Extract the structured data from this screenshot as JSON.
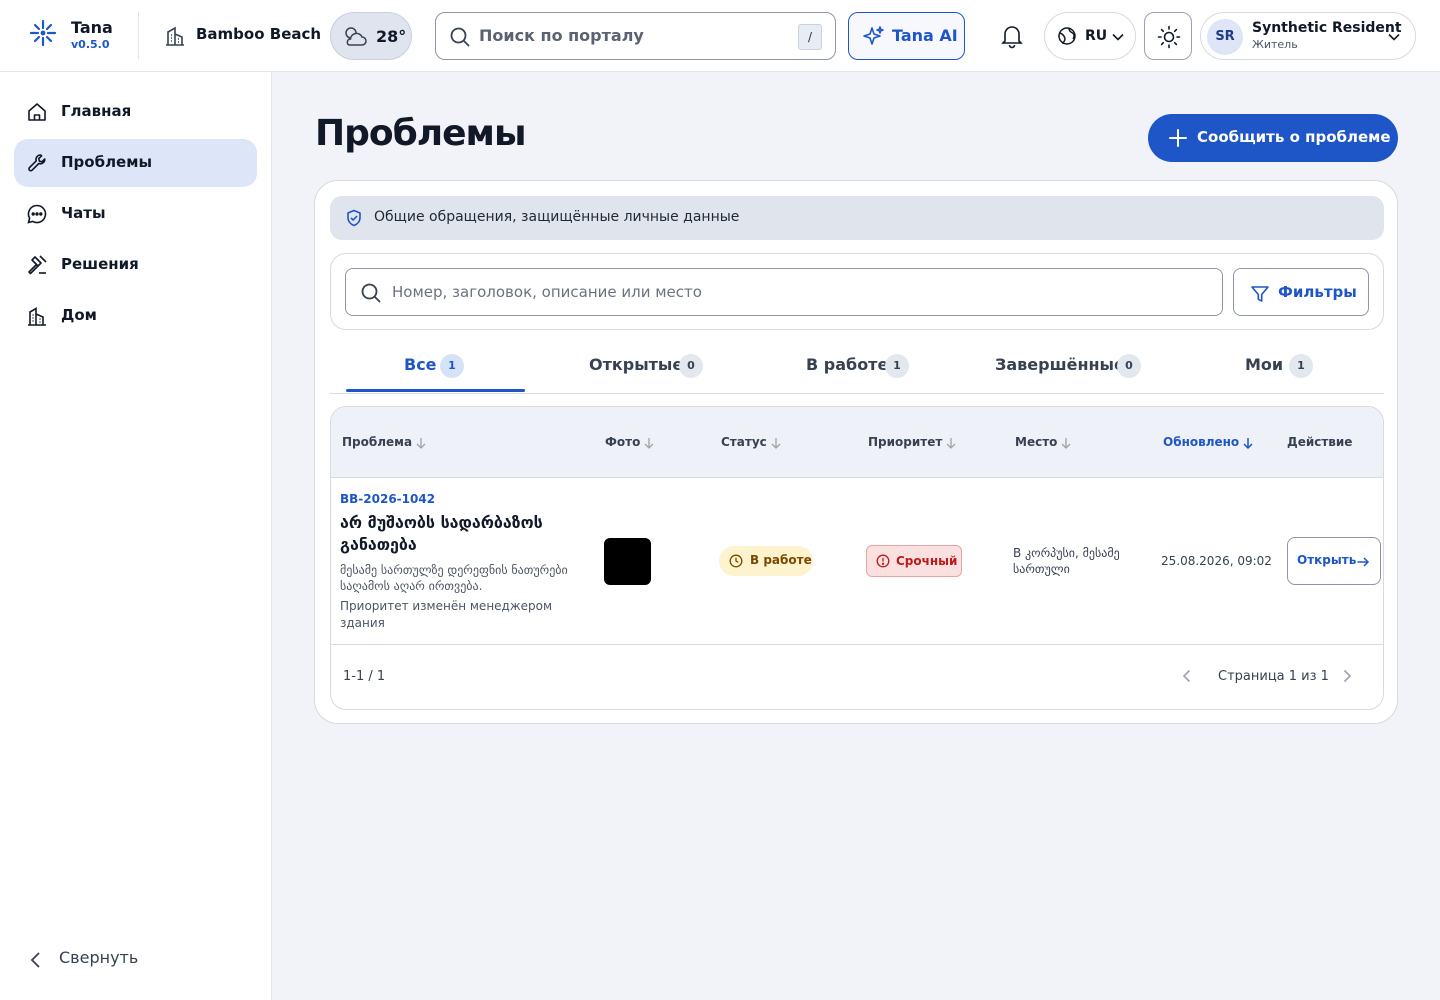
{
  "header": {
    "brand_name": "Tana",
    "brand_version": "v0.5.0",
    "building_name": "Bamboo Beach",
    "weather_temp": "28°",
    "search_placeholder": "Поиск по порталу",
    "search_shortcut": "/",
    "ai_label": "Tana AI",
    "language": "RU",
    "user_initials": "SR",
    "user_name": "Synthetic Resident",
    "user_role": "Житель"
  },
  "sidebar": {
    "items": [
      {
        "label": "Главная",
        "icon": "home-icon",
        "active": false
      },
      {
        "label": "Проблемы",
        "icon": "wrench-icon",
        "active": true
      },
      {
        "label": "Чаты",
        "icon": "chat-icon",
        "active": false
      },
      {
        "label": "Решения",
        "icon": "gavel-icon",
        "active": false
      },
      {
        "label": "Дом",
        "icon": "building-icon",
        "active": false
      }
    ],
    "collapse_label": "Свернуть"
  },
  "main": {
    "title": "Проблемы",
    "report_button": "Сообщить о проблеме",
    "notice": "Общие обращения, защищённые личные данные",
    "search_placeholder": "Номер, заголовок, описание или место",
    "filters_button": "Фильтры",
    "tabs": [
      {
        "label": "Все",
        "count": "1",
        "active": true
      },
      {
        "label": "Открытые",
        "count": "0",
        "active": false
      },
      {
        "label": "В работе",
        "count": "1",
        "active": false
      },
      {
        "label": "Завершённые",
        "count": "0",
        "active": false
      },
      {
        "label": "Мои",
        "count": "1",
        "active": false
      }
    ]
  },
  "table": {
    "columns": [
      "Проблема",
      "Фото",
      "Статус",
      "Приоритет",
      "Место",
      "Обновлено",
      "Действие"
    ],
    "sorted_column": "Обновлено",
    "rows": [
      {
        "id": "BB-2026-1042",
        "title": "არ მუშაობს სადარბაზოს განათება",
        "description": "მესამე სართულზე დერეფნის ნათურები საღამოს აღარ ირთვება.",
        "note": "Приоритет изменён менеджером здания",
        "status": "В работе",
        "priority": "Срочный",
        "place": "B კორპუსი, მესამე სართული",
        "updated": "25.08.2026, 09:02",
        "action": "Открыть"
      }
    ],
    "range": "1-1 / 1",
    "page_label": "Страница 1 из 1"
  },
  "colors": {
    "accent": "#1e56c8",
    "active_nav_bg": "#dce6f8",
    "status_bg": "#fdf3cf",
    "priority_bg": "#fbe0e0"
  }
}
